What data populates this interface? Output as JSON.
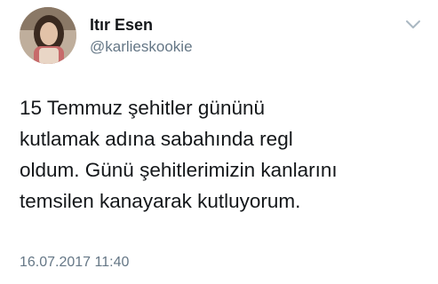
{
  "tweet": {
    "author": {
      "name": "Itır Esen",
      "handle": "@karlieskookie",
      "avatar_icon": "avatar-photo"
    },
    "menu_icon": "chevron-down-icon",
    "text_lines": [
      "15 Temmuz şehitler gününü",
      "kutlamak adına sabahında regl",
      "oldum. Günü şehitlerimizin kanlarını",
      "temsilen kanayarak kutluyorum."
    ],
    "timestamp": "16.07.2017 11:40"
  },
  "colors": {
    "text": "#14171a",
    "secondary": "#657786",
    "chevron": "#aab8c2",
    "background": "#ffffff"
  }
}
